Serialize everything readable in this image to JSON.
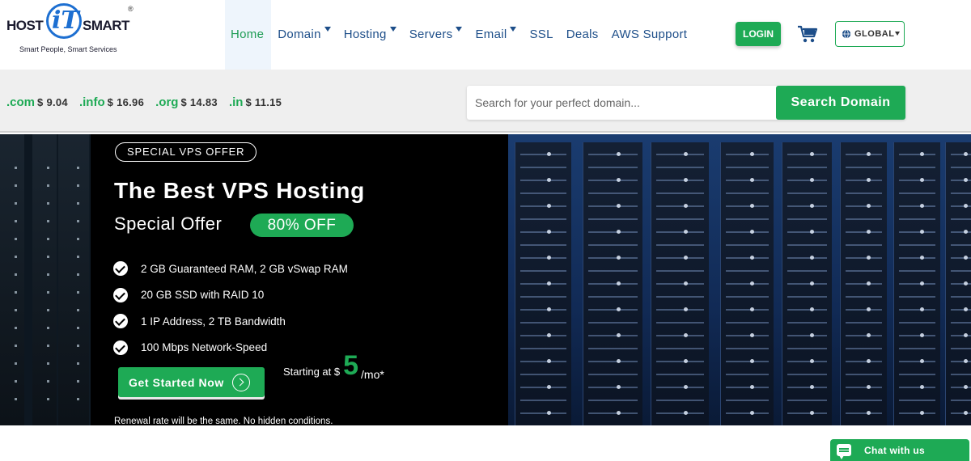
{
  "brand": {
    "host": "HOST",
    "it": "iT",
    "smart": "SMART",
    "registered": "®",
    "tagline": "Smart People, Smart Services"
  },
  "nav": {
    "items": [
      {
        "label": "Home",
        "active": true,
        "dropdown": false
      },
      {
        "label": "Domain",
        "active": false,
        "dropdown": true
      },
      {
        "label": "Hosting",
        "active": false,
        "dropdown": true
      },
      {
        "label": "Servers",
        "active": false,
        "dropdown": true
      },
      {
        "label": "Email",
        "active": false,
        "dropdown": true
      },
      {
        "label": "SSL",
        "active": false,
        "dropdown": false
      },
      {
        "label": "Deals",
        "active": false,
        "dropdown": false
      },
      {
        "label": "AWS Support",
        "active": false,
        "dropdown": false
      }
    ],
    "login_label": "LOGIN",
    "cart_icon": "cart-icon",
    "region_label": "GLOBAL"
  },
  "domain_prices": [
    {
      "tld": ".com",
      "price": "$ 9.04"
    },
    {
      "tld": ".info",
      "price": "$ 16.96"
    },
    {
      "tld": ".org",
      "price": "$ 14.83"
    },
    {
      "tld": ".in",
      "price": "$ 11.15"
    }
  ],
  "search": {
    "placeholder": "Search for your perfect domain...",
    "button_label": "Search Domain"
  },
  "hero": {
    "badge": "SPECIAL VPS OFFER",
    "title": "The Best VPS Hosting",
    "subtitle": "Special Offer",
    "discount": "80% OFF",
    "features": [
      "2 GB Guaranteed RAM, 2 GB vSwap RAM",
      "20 GB SSD with RAID 10",
      "1 IP Address, 2 TB Bandwidth",
      "100 Mbps Network-Speed"
    ],
    "cta_label": "Get Started Now",
    "starting_label": "Starting at $",
    "price": "5",
    "per": "/mo*",
    "renewal_note": "Renewal rate will be the same. No hidden conditions."
  },
  "chat": {
    "label": "Chat with us"
  },
  "colors": {
    "accent_green": "#1eaa55",
    "nav_blue": "#1d4e89",
    "logo_blue": "#1d6fd1"
  }
}
